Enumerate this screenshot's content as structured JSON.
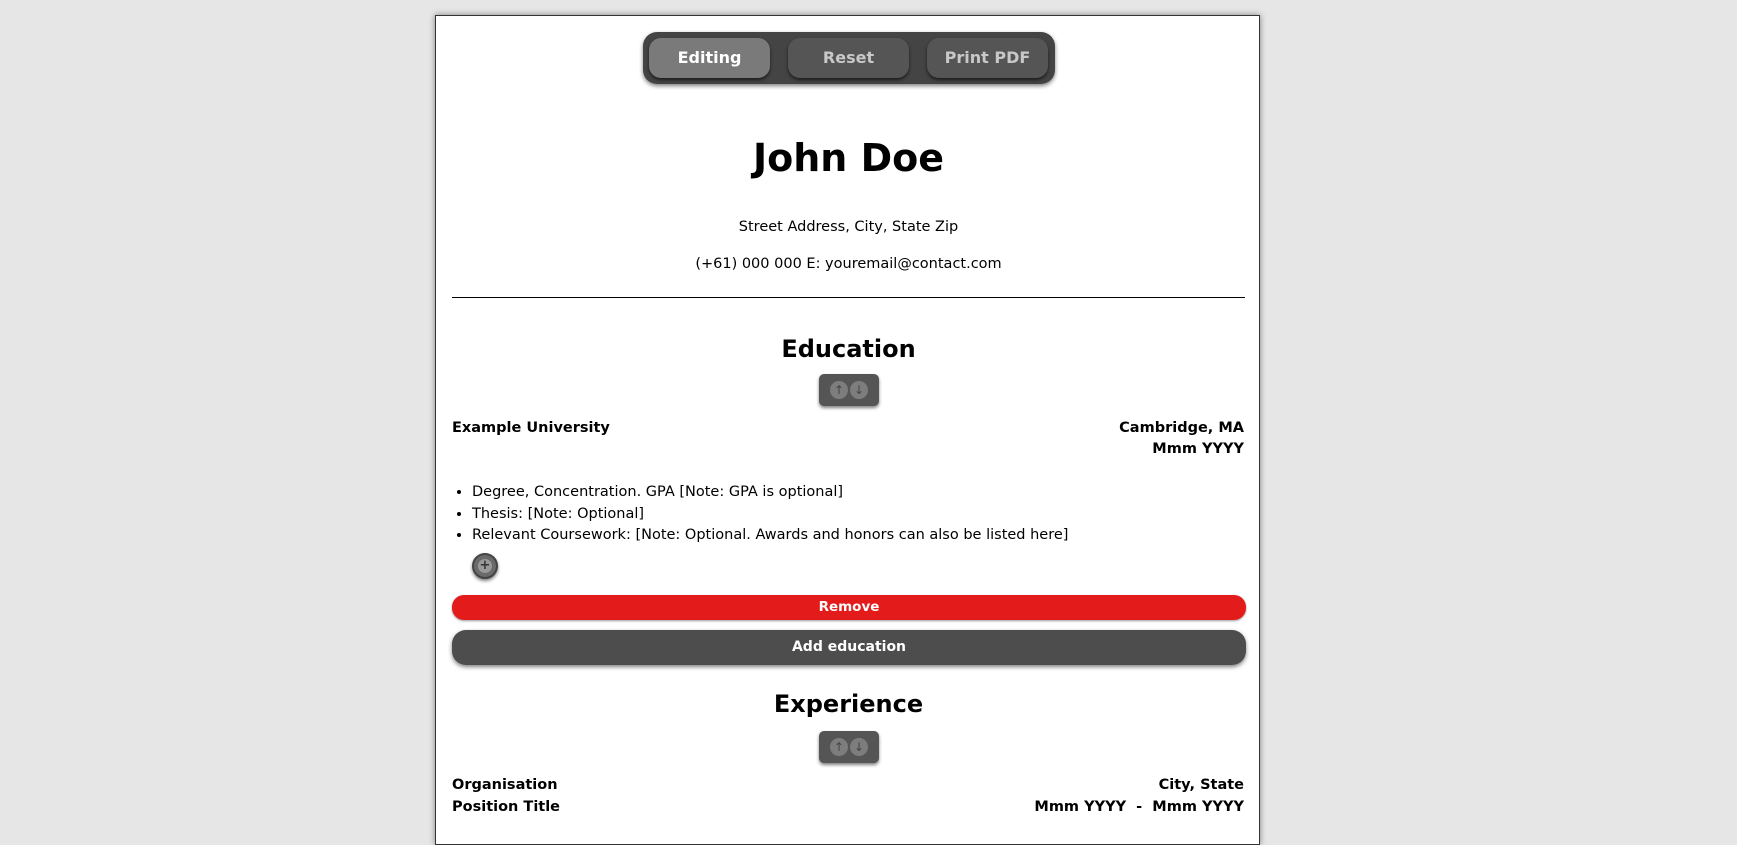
{
  "toolbar": {
    "editing_label": "Editing",
    "reset_label": "Reset",
    "print_label": "Print PDF"
  },
  "header": {
    "name": "John Doe",
    "address": "Street Address, City, State Zip",
    "contact": "(+61) 000 000 E: youremail@contact.com"
  },
  "education": {
    "title": "Education",
    "entries": [
      {
        "institution": "Example University",
        "location": "Cambridge, MA",
        "date": "Mmm YYYY",
        "bullets": [
          "Degree, Concentration. GPA [Note: GPA is optional]",
          "Thesis: [Note: Optional]",
          "Relevant Coursework: [Note: Optional. Awards and honors can also be listed here]"
        ]
      }
    ],
    "remove_label": "Remove",
    "add_label": "Add education"
  },
  "experience": {
    "title": "Experience",
    "entries": [
      {
        "organisation": "Organisation",
        "location": "City, State",
        "position": "Position Title",
        "dates": "Mmm YYYY  -  Mmm YYYY"
      }
    ]
  },
  "icons": {
    "move_up": "arrow-up-icon",
    "move_down": "arrow-down-icon",
    "add_bullet": "plus-icon"
  },
  "colors": {
    "background": "#e6e6e6",
    "remove": "#e31b1b",
    "dark_button": "#4d4d4d",
    "active_tab": "#7a7a7a"
  }
}
